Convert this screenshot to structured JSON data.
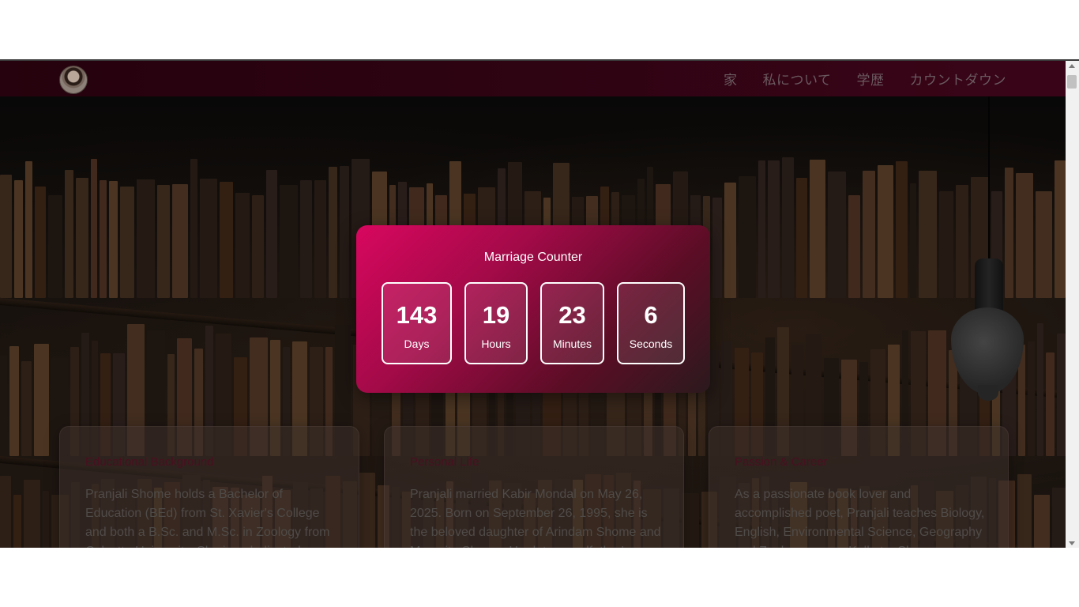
{
  "nav": {
    "avatar_icon": "profile-photo",
    "links": [
      "家",
      "私について",
      "学歴",
      "カウントダウン"
    ]
  },
  "counter": {
    "title": "Marriage Counter",
    "units": [
      {
        "value": "143",
        "label": "Days"
      },
      {
        "value": "19",
        "label": "Hours"
      },
      {
        "value": "23",
        "label": "Minutes"
      },
      {
        "value": "6",
        "label": "Seconds"
      }
    ]
  },
  "cards": [
    {
      "title": "Educational Background",
      "text": "Pranjali Shome holds a Bachelor of Education (BEd) from St. Xavier's College and both a B.Sc. and M.Sc. in Zoology from Calcutta University. She is a dedicated"
    },
    {
      "title": "Personal Life",
      "text": "Pranjali married Kabir Mondal on May 26, 2025. Born on September 26, 1995, she is the beloved daughter of Arindam Shome and Moumita Shome. Her late grandfather's"
    },
    {
      "title": "Passion & Career",
      "text": "As a passionate book lover and accomplished poet, Pranjali teaches Biology, English, Environmental Science, Geography and Zoology across Kolkata. She"
    }
  ],
  "colors": {
    "nav_bg": "#2e0312",
    "counter_gradient_start": "#d8075f",
    "counter_gradient_end": "#2b1a1d",
    "card_title": "#4a0f1f"
  }
}
